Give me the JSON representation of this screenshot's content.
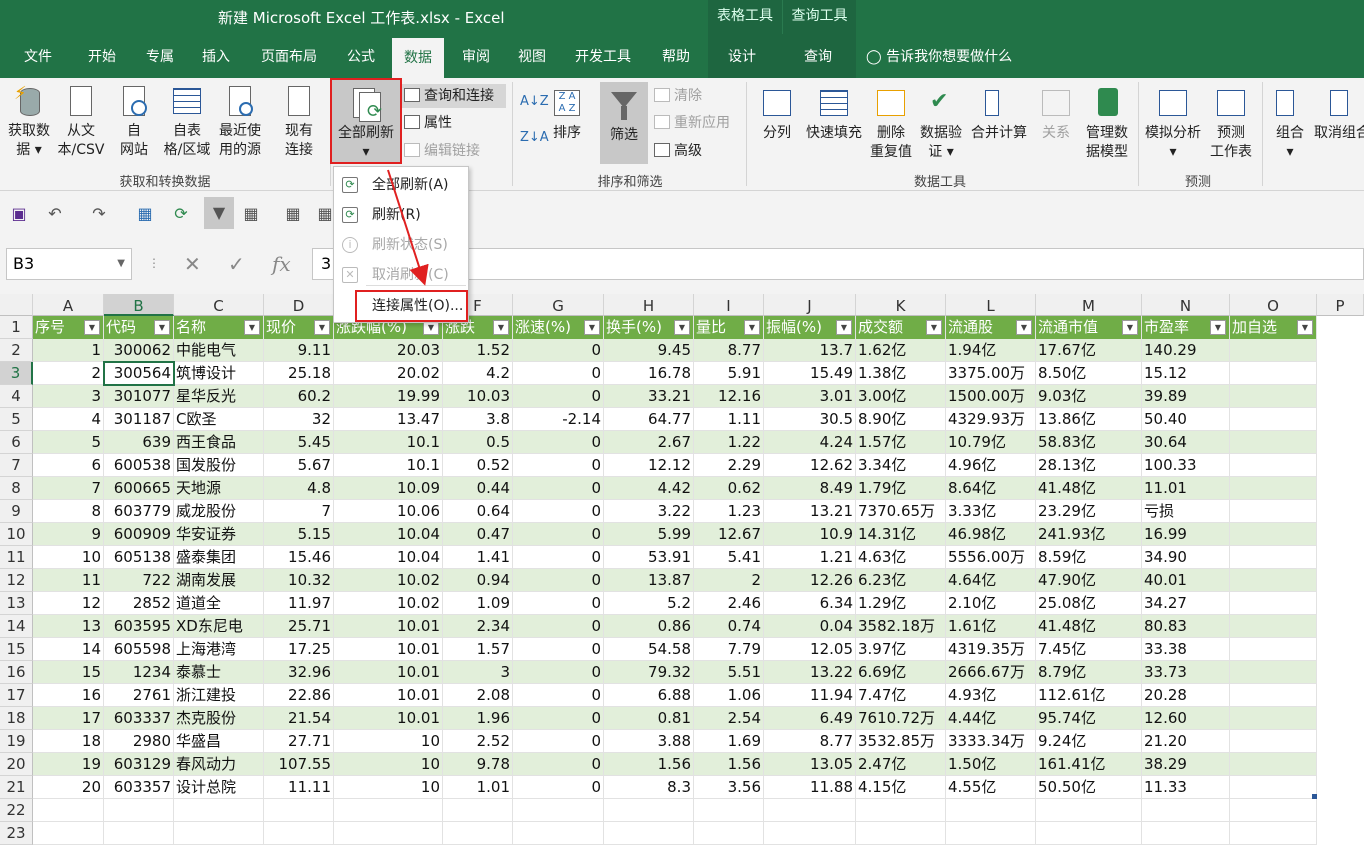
{
  "window": {
    "title": "新建 Microsoft Excel 工作表.xlsx  -  Excel",
    "ctx_table": "表格工具",
    "ctx_query": "查询工具"
  },
  "tabs": [
    "文件",
    "开始",
    "专属",
    "插入",
    "页面布局",
    "公式",
    "数据",
    "审阅",
    "视图",
    "开发工具",
    "帮助",
    "设计",
    "查询"
  ],
  "tell_me": "告诉我你想要做什么",
  "ribbon": {
    "get_data": "获取数",
    "get_data2": "据",
    "from_text": "从文",
    "from_text2": "本/CSV",
    "from_web": "自",
    "from_web2": "网站",
    "from_table": "自表",
    "from_table2": "格/区域",
    "recent": "最近使",
    "recent2": "用的源",
    "existing": "现有",
    "existing2": "连接",
    "refresh_all": "全部刷新",
    "query_conn": "查询和连接",
    "properties": "属性",
    "edit_links": "编辑链接",
    "sort": "排序",
    "filter": "筛选",
    "clear": "清除",
    "reapply": "重新应用",
    "advanced": "高级",
    "split": "分列",
    "flash": "快速填充",
    "remove_dup": "删除",
    "remove_dup2": "重复值",
    "validate": "数据验",
    "validate2": "证",
    "consolidate": "合并计算",
    "relations": "关系",
    "model": "管理数",
    "model2": "据模型",
    "whatif": "模拟分析",
    "forecast": "预测",
    "forecast2": "工作表",
    "group": "组合",
    "ungroup": "取消组合",
    "grp_get": "获取和转换数据",
    "grp_sort": "排序和筛选",
    "grp_tools": "数据工具",
    "grp_forecast": "预测"
  },
  "menu": {
    "items": [
      "全部刷新(A)",
      "刷新(R)",
      "刷新状态(S)",
      "取消刷新(C)",
      "连接属性(O)..."
    ]
  },
  "name_box": "B3",
  "formula_value": "3",
  "columns": [
    "A",
    "B",
    "C",
    "D",
    "E",
    "F",
    "G",
    "H",
    "I",
    "J",
    "K",
    "L",
    "M",
    "N",
    "O",
    "P"
  ],
  "headers": [
    "序号",
    "代码",
    "名称",
    "现价",
    "涨跌幅(%)",
    "涨跌",
    "涨速(%)",
    "换手(%)",
    "量比",
    "振幅(%)",
    "成交额",
    "流通股",
    "流通市值",
    "市盈率",
    "加自选"
  ],
  "rows": [
    [
      "1",
      "300062",
      "中能电气",
      "9.11",
      "20.03",
      "1.52",
      "0",
      "9.45",
      "8.77",
      "13.7",
      "1.62亿",
      "1.94亿",
      "17.67亿",
      "140.29"
    ],
    [
      "2",
      "300564",
      "筑博设计",
      "25.18",
      "20.02",
      "4.2",
      "0",
      "16.78",
      "5.91",
      "15.49",
      "1.38亿",
      "3375.00万",
      "8.50亿",
      "15.12"
    ],
    [
      "3",
      "301077",
      "星华反光",
      "60.2",
      "19.99",
      "10.03",
      "0",
      "33.21",
      "12.16",
      "3.01",
      "3.00亿",
      "1500.00万",
      "9.03亿",
      "39.89"
    ],
    [
      "4",
      "301187",
      "C欧圣",
      "32",
      "13.47",
      "3.8",
      "-2.14",
      "64.77",
      "1.11",
      "30.5",
      "8.90亿",
      "4329.93万",
      "13.86亿",
      "50.40"
    ],
    [
      "5",
      "639",
      "西王食品",
      "5.45",
      "10.1",
      "0.5",
      "0",
      "2.67",
      "1.22",
      "4.24",
      "1.57亿",
      "10.79亿",
      "58.83亿",
      "30.64"
    ],
    [
      "6",
      "600538",
      "国发股份",
      "5.67",
      "10.1",
      "0.52",
      "0",
      "12.12",
      "2.29",
      "12.62",
      "3.34亿",
      "4.96亿",
      "28.13亿",
      "100.33"
    ],
    [
      "7",
      "600665",
      "天地源",
      "4.8",
      "10.09",
      "0.44",
      "0",
      "4.42",
      "0.62",
      "8.49",
      "1.79亿",
      "8.64亿",
      "41.48亿",
      "11.01"
    ],
    [
      "8",
      "603779",
      "威龙股份",
      "7",
      "10.06",
      "0.64",
      "0",
      "3.22",
      "1.23",
      "13.21",
      "7370.65万",
      "3.33亿",
      "23.29亿",
      "亏损"
    ],
    [
      "9",
      "600909",
      "华安证券",
      "5.15",
      "10.04",
      "0.47",
      "0",
      "5.99",
      "12.67",
      "10.9",
      "14.31亿",
      "46.98亿",
      "241.93亿",
      "16.99"
    ],
    [
      "10",
      "605138",
      "盛泰集团",
      "15.46",
      "10.04",
      "1.41",
      "0",
      "53.91",
      "5.41",
      "1.21",
      "4.63亿",
      "5556.00万",
      "8.59亿",
      "34.90"
    ],
    [
      "11",
      "722",
      "湖南发展",
      "10.32",
      "10.02",
      "0.94",
      "0",
      "13.87",
      "2",
      "12.26",
      "6.23亿",
      "4.64亿",
      "47.90亿",
      "40.01"
    ],
    [
      "12",
      "2852",
      "道道全",
      "11.97",
      "10.02",
      "1.09",
      "0",
      "5.2",
      "2.46",
      "6.34",
      "1.29亿",
      "2.10亿",
      "25.08亿",
      "34.27"
    ],
    [
      "13",
      "603595",
      "XD东尼电",
      "25.71",
      "10.01",
      "2.34",
      "0",
      "0.86",
      "0.74",
      "0.04",
      "3582.18万",
      "1.61亿",
      "41.48亿",
      "80.83"
    ],
    [
      "14",
      "605598",
      "上海港湾",
      "17.25",
      "10.01",
      "1.57",
      "0",
      "54.58",
      "7.79",
      "12.05",
      "3.97亿",
      "4319.35万",
      "7.45亿",
      "33.38"
    ],
    [
      "15",
      "1234",
      "泰慕士",
      "32.96",
      "10.01",
      "3",
      "0",
      "79.32",
      "5.51",
      "13.22",
      "6.69亿",
      "2666.67万",
      "8.79亿",
      "33.73"
    ],
    [
      "16",
      "2761",
      "浙江建投",
      "22.86",
      "10.01",
      "2.08",
      "0",
      "6.88",
      "1.06",
      "11.94",
      "7.47亿",
      "4.93亿",
      "112.61亿",
      "20.28"
    ],
    [
      "17",
      "603337",
      "杰克股份",
      "21.54",
      "10.01",
      "1.96",
      "0",
      "0.81",
      "2.54",
      "6.49",
      "7610.72万",
      "4.44亿",
      "95.74亿",
      "12.60"
    ],
    [
      "18",
      "2980",
      "华盛昌",
      "27.71",
      "10",
      "2.52",
      "0",
      "3.88",
      "1.69",
      "8.77",
      "3532.85万",
      "3333.34万",
      "9.24亿",
      "21.20"
    ],
    [
      "19",
      "603129",
      "春风动力",
      "107.55",
      "10",
      "9.78",
      "0",
      "1.56",
      "1.56",
      "13.05",
      "2.47亿",
      "1.50亿",
      "161.41亿",
      "38.29"
    ],
    [
      "20",
      "603357",
      "设计总院",
      "11.11",
      "10",
      "1.01",
      "0",
      "8.3",
      "3.56",
      "11.88",
      "4.15亿",
      "4.55亿",
      "50.50亿",
      "11.33"
    ]
  ],
  "row_numbers": [
    "1",
    "2",
    "3",
    "4",
    "5",
    "6",
    "7",
    "8",
    "9",
    "10",
    "11",
    "12",
    "13",
    "14",
    "15",
    "16",
    "17",
    "18",
    "19",
    "20",
    "21",
    "22",
    "23"
  ]
}
